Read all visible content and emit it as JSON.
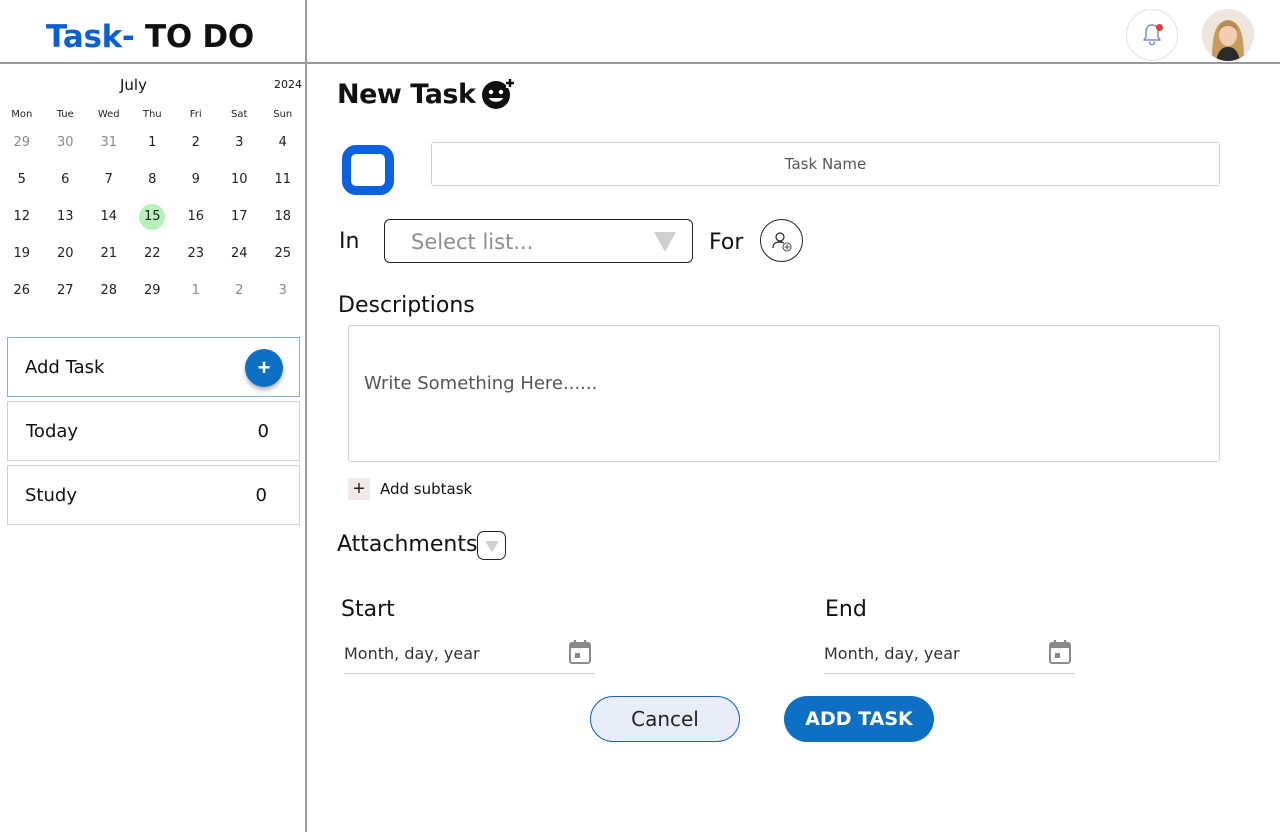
{
  "app": {
    "logo_accent": "Task-",
    "logo_rest": " TO DO",
    "accent_color": "#0b5fd1"
  },
  "header": {
    "notification_icon": "bell-icon",
    "has_unread": true,
    "avatar": "user-avatar"
  },
  "calendar": {
    "month": "July",
    "year": "2024",
    "weekdays": [
      "Mon",
      "Tue",
      "Wed",
      "Thu",
      "Fri",
      "Sat",
      "Sun"
    ],
    "weeks": [
      [
        "29",
        "30",
        "31",
        "1",
        "2",
        "3",
        "4"
      ],
      [
        "5",
        "6",
        "7",
        "8",
        "9",
        "10",
        "11"
      ],
      [
        "12",
        "13",
        "14",
        "15",
        "16",
        "17",
        "18"
      ],
      [
        "19",
        "20",
        "21",
        "22",
        "23",
        "24",
        "25"
      ],
      [
        "26",
        "27",
        "28",
        "29",
        "1",
        "2",
        "3"
      ]
    ],
    "selected_day": "15",
    "today_color": "#b5f2b8"
  },
  "sidebar": {
    "add_task_label": "Add Task",
    "add_icon": "plus-icon",
    "lists": [
      {
        "label": "Today",
        "count": "0"
      },
      {
        "label": "Study",
        "count": "0"
      }
    ]
  },
  "form": {
    "title": "New Task",
    "title_icon": "emoji-add-icon",
    "task_name_placeholder": "Task Name",
    "in_label": "In",
    "list_placeholder": "Select list...",
    "for_label": "For",
    "descriptions_label": "Descriptions",
    "description_placeholder": "Write Something Here......",
    "add_subtask_label": "Add subtask",
    "attachments_label": "Attachments",
    "start_label": "Start",
    "end_label": "End",
    "start_placeholder": "Month, day, year",
    "end_placeholder": "Month, day, year",
    "cancel_label": "Cancel",
    "add_task_button": "ADD TASK",
    "primary_color": "#0e70c4",
    "checkbox_color": "#0b62e0"
  }
}
